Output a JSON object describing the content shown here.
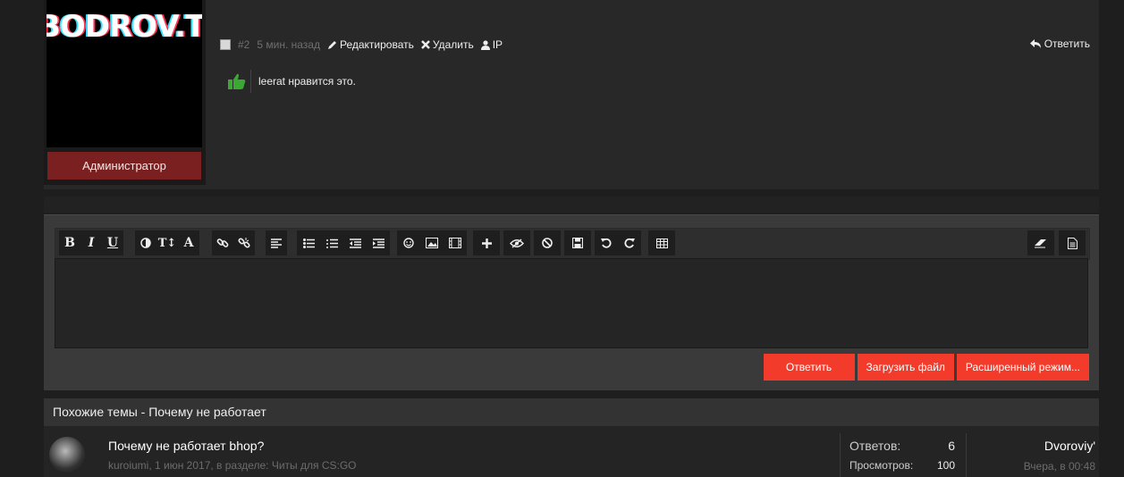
{
  "post": {
    "avatar_text": "BODROV.TK",
    "role": "Администратор",
    "number": "#2",
    "time": "5 мин. назад",
    "edit_label": "Редактировать",
    "delete_label": "Удалить",
    "ip_label": "IP",
    "reply_label": "Ответить",
    "likes_text": "leerat нравится это."
  },
  "editor": {
    "toolbar_icons": [
      "bold-icon",
      "italic-icon",
      "underline-icon",
      "color-icon",
      "font-size-icon",
      "font-icon",
      "link-icon",
      "unlink-icon",
      "align-icon",
      "bullet-list-icon",
      "numbered-list-icon",
      "outdent-icon",
      "indent-icon",
      "smiley-icon",
      "image-icon",
      "media-icon",
      "insert-icon",
      "spoiler-icon",
      "remove-format-icon",
      "save-draft-icon",
      "undo-icon",
      "redo-icon",
      "table-icon",
      "eraser-icon",
      "source-icon"
    ],
    "submit_label": "Ответить",
    "upload_label": "Загрузить файл",
    "advanced_label": "Расширенный режим..."
  },
  "similar": {
    "heading": "Похожие темы - Почему не работает",
    "threads": [
      {
        "title": "Почему не работает bhop?",
        "subtitle": "kuroiumi, 1 июн 2017, в разделе: Читы для CS:GO",
        "replies_label": "Ответов:",
        "replies": "6",
        "views_label": "Просмотров:",
        "views": "100",
        "last_user": "Dvoroviy'",
        "last_time": "Вчера, в 00:48"
      }
    ]
  },
  "colors": {
    "accent": "#f33b2b",
    "role_bg": "#7a2020",
    "like_green": "#3aa832"
  }
}
